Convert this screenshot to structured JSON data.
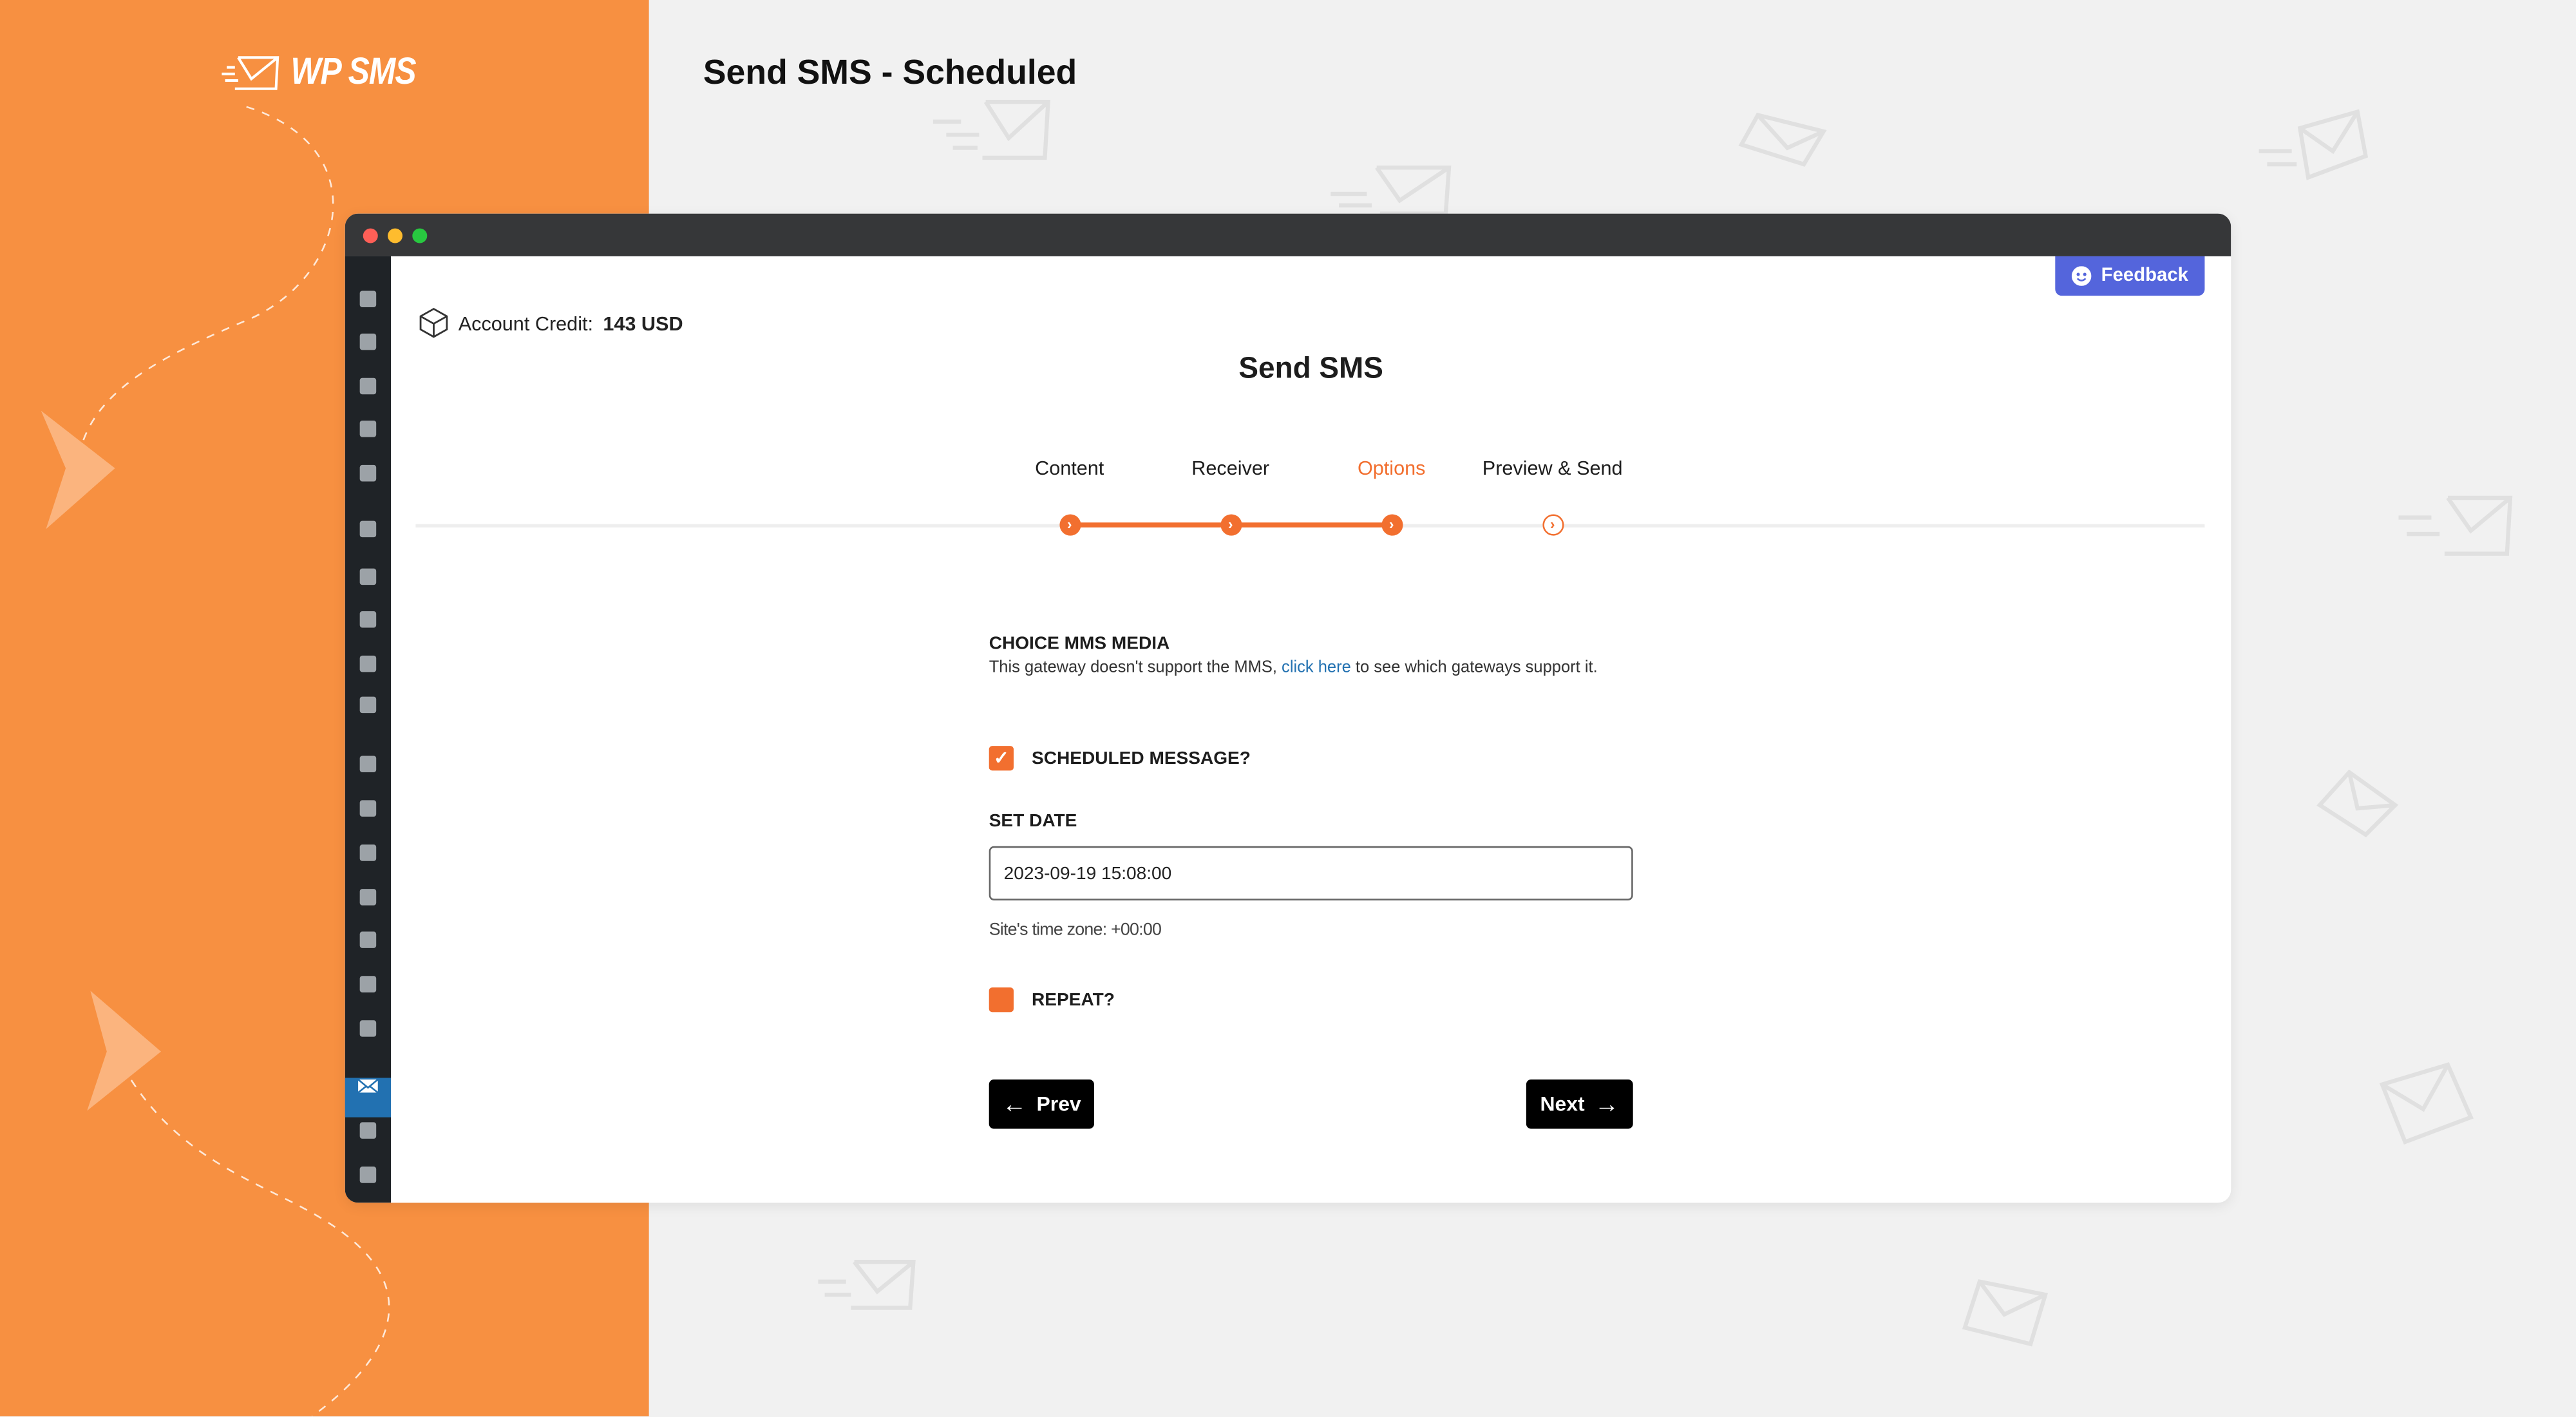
{
  "brand": {
    "logo_text": "WP SMS"
  },
  "page_title": "Send SMS - Scheduled",
  "feedback_label": "Feedback",
  "account": {
    "label": "Account Credit:",
    "value": "143 USD"
  },
  "heading": "Send SMS",
  "steps": [
    {
      "label": "Content",
      "state": "done"
    },
    {
      "label": "Receiver",
      "state": "done"
    },
    {
      "label": "Options",
      "state": "current"
    },
    {
      "label": "Preview & Send",
      "state": "todo"
    }
  ],
  "form": {
    "mms_label": "CHOICE MMS MEDIA",
    "mms_desc_before": "This gateway doesn't support the MMS,",
    "mms_link": "click here",
    "mms_desc_after": "to see which gateways support it.",
    "scheduled_label": "SCHEDULED MESSAGE?",
    "scheduled_checked": true,
    "set_date_label": "SET DATE",
    "date_value": "2023-09-19 15:08:00",
    "timezone_text": "Site's time zone: +00:00",
    "repeat_label": "REPEAT?",
    "repeat_checked": false
  },
  "buttons": {
    "prev": "Prev",
    "next": "Next"
  },
  "colors": {
    "brand_orange": "#f79041",
    "accent": "#f26f2f",
    "feedback": "#5465dc",
    "link": "#2271b1",
    "wp_active": "#2271b1"
  },
  "sidebar_icons": [
    "pin-icon",
    "media-icon",
    "pages-icon",
    "comments-icon",
    "gallery-icon",
    "woo-icon",
    "archive-icon",
    "chart-bar-icon",
    "megaphone-icon",
    "forms-icon",
    "appearance-icon",
    "plugins-icon",
    "users-icon",
    "tools-icon",
    "sliders-icon",
    "layout-icon",
    "settings-icon",
    "sms-envelope-icon",
    "pie-chart-icon",
    "analytics-icon"
  ]
}
